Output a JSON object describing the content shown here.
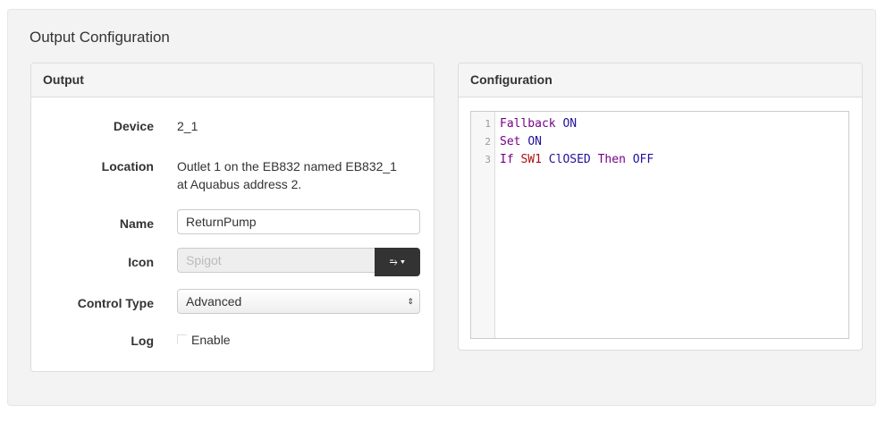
{
  "page_title": "Output Configuration",
  "output_panel": {
    "heading": "Output",
    "device_label": "Device",
    "device_value": "2_1",
    "location_label": "Location",
    "location_line1": "Outlet 1 on the EB832 named EB832_1",
    "location_line2": "at Aquabus address 2.",
    "name_label": "Name",
    "name_value": "ReturnPump",
    "icon_label": "Icon",
    "icon_placeholder": "Spigot",
    "control_type_label": "Control Type",
    "control_type_value": "Advanced",
    "log_label": "Log",
    "log_checkbox_label": "Enable"
  },
  "config_panel": {
    "heading": "Configuration",
    "lines": [
      {
        "n": "1",
        "t": [
          [
            "kw",
            "Fallback"
          ],
          [
            "",
            ""
          ],
          [
            "v",
            "ON"
          ]
        ]
      },
      {
        "n": "2",
        "t": [
          [
            "kw",
            "Set"
          ],
          [
            "v",
            "ON"
          ]
        ]
      },
      {
        "n": "3",
        "t": [
          [
            "kw",
            "If"
          ],
          [
            "id",
            "SW1"
          ],
          [
            "v",
            "ClOSED"
          ],
          [
            "kw",
            "Then"
          ],
          [
            "v",
            "OFF"
          ]
        ]
      }
    ]
  }
}
